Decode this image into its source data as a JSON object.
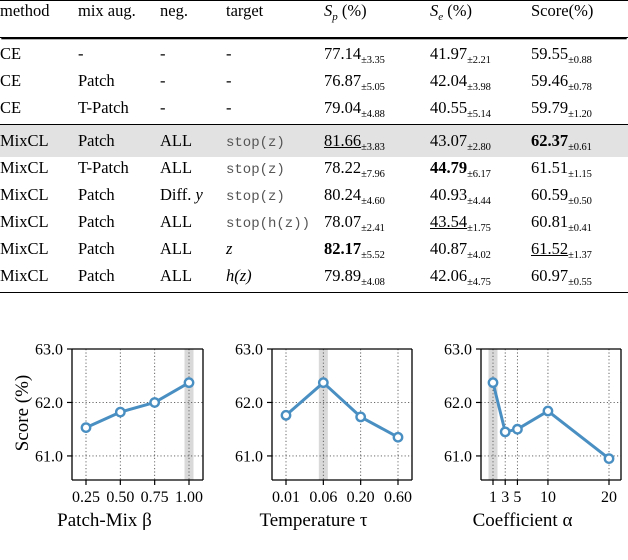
{
  "table": {
    "headers": [
      "method",
      "mix aug.",
      "neg.",
      "target",
      "Sp (%)",
      "Se (%)",
      "Score (%)"
    ],
    "header_parts": {
      "method": "method",
      "mix_aug": "mix aug.",
      "neg": "neg.",
      "target": "target",
      "sp_sym": "S",
      "sp_sub": "p",
      "sp_unit": "(%)",
      "se_sym": "S",
      "se_sub": "e",
      "se_unit": "(%)",
      "score": "Score",
      "score_unit": "(%)"
    },
    "rows": [
      {
        "method": "CE",
        "mix": "-",
        "neg": "-",
        "target": "-",
        "target_style": "plain",
        "sp": "77.14",
        "sp_err": "±3.35",
        "sp_style": "plain",
        "se": "41.97",
        "se_err": "±2.21",
        "se_style": "plain",
        "score": "59.55",
        "score_err": "±0.88",
        "score_style": "plain",
        "highlight": false
      },
      {
        "method": "CE",
        "mix": "Patch",
        "neg": "-",
        "target": "-",
        "target_style": "plain",
        "sp": "76.87",
        "sp_err": "±5.05",
        "sp_style": "plain",
        "se": "42.04",
        "se_err": "±3.98",
        "se_style": "plain",
        "score": "59.46",
        "score_err": "±0.78",
        "score_style": "plain",
        "highlight": false
      },
      {
        "method": "CE",
        "mix": "T-Patch",
        "neg": "-",
        "target": "-",
        "target_style": "plain",
        "sp": "79.04",
        "sp_err": "±4.88",
        "sp_style": "plain",
        "se": "40.55",
        "se_err": "±5.14",
        "se_style": "plain",
        "score": "59.79",
        "score_err": "±1.20",
        "score_style": "plain",
        "highlight": false
      },
      {
        "method": "MixCL",
        "mix": "Patch",
        "neg": "ALL",
        "target": "stop(z)",
        "target_style": "mono",
        "sp": "81.66",
        "sp_err": "±3.83",
        "sp_style": "underline",
        "se": "43.07",
        "se_err": "±2.80",
        "se_style": "plain",
        "score": "62.37",
        "score_err": "±0.61",
        "score_style": "bold",
        "highlight": true
      },
      {
        "method": "MixCL",
        "mix": "T-Patch",
        "neg": "ALL",
        "target": "stop(z)",
        "target_style": "mono",
        "sp": "78.22",
        "sp_err": "±7.96",
        "sp_style": "plain",
        "se": "44.79",
        "se_err": "±6.17",
        "se_style": "bold",
        "score": "61.51",
        "score_err": "±1.15",
        "score_style": "plain",
        "highlight": false
      },
      {
        "method": "MixCL",
        "mix": "Patch",
        "neg": "Diff. y",
        "neg_style": "math-y",
        "target": "stop(z)",
        "target_style": "mono",
        "sp": "80.24",
        "sp_err": "±4.60",
        "sp_style": "plain",
        "se": "40.93",
        "se_err": "±4.44",
        "se_style": "plain",
        "score": "60.59",
        "score_err": "±0.50",
        "score_style": "plain",
        "highlight": false
      },
      {
        "method": "MixCL",
        "mix": "Patch",
        "neg": "ALL",
        "target": "stop(h(z))",
        "target_style": "mono",
        "sp": "78.07",
        "sp_err": "±2.41",
        "sp_style": "plain",
        "se": "43.54",
        "se_err": "±1.75",
        "se_style": "underline",
        "score": "60.81",
        "score_err": "±0.41",
        "score_style": "plain",
        "highlight": false
      },
      {
        "method": "MixCL",
        "mix": "Patch",
        "neg": "ALL",
        "target": "z",
        "target_style": "math",
        "sp": "82.17",
        "sp_err": "±5.52",
        "sp_style": "bold",
        "se": "40.87",
        "se_err": "±4.02",
        "se_style": "plain",
        "score": "61.52",
        "score_err": "±1.37",
        "score_style": "underline",
        "highlight": false
      },
      {
        "method": "MixCL",
        "mix": "Patch",
        "neg": "ALL",
        "target": "h(z)",
        "target_style": "math",
        "sp": "79.89",
        "sp_err": "±4.08",
        "sp_style": "plain",
        "se": "42.06",
        "se_err": "±4.75",
        "se_style": "plain",
        "score": "60.97",
        "score_err": "±0.55",
        "score_style": "plain",
        "highlight": false
      }
    ]
  },
  "colors": {
    "line": "#4a8fc2",
    "marker_face": "#ffffff",
    "highlight_band": "#cccccc",
    "grid": "#555555",
    "axis": "#000000",
    "row_highlight": "#e2e2e2"
  },
  "chart_data": [
    {
      "type": "line",
      "title": "",
      "xlabel": "Patch-Mix β",
      "ylabel": "Score (%)",
      "x": [
        0.25,
        0.5,
        0.75,
        1.0
      ],
      "xtick_labels": [
        "0.25",
        "0.50",
        "0.75",
        "1.00"
      ],
      "values": [
        61.53,
        61.82,
        62.0,
        62.37
      ],
      "ytick_labels": [
        "61.0",
        "62.0",
        "63.0"
      ],
      "yticks": [
        61.0,
        62.0,
        63.0
      ],
      "ylim": [
        60.55,
        63.0
      ],
      "grid": true,
      "highlight_x": 1.0,
      "legend": "none"
    },
    {
      "type": "line",
      "title": "",
      "xlabel": "Temperature τ",
      "ylabel": "",
      "x": [
        0.01,
        0.06,
        0.2,
        0.6
      ],
      "xtick_labels": [
        "0.01",
        "0.06",
        "0.20",
        "0.60"
      ],
      "values": [
        61.76,
        62.37,
        61.73,
        61.35
      ],
      "ytick_labels": [
        "61.0",
        "62.0",
        "63.0"
      ],
      "yticks": [
        61.0,
        62.0,
        63.0
      ],
      "ylim": [
        60.55,
        63.0
      ],
      "grid": true,
      "highlight_x": 0.06,
      "legend": "none"
    },
    {
      "type": "line",
      "title": "",
      "xlabel": "Coefficient α",
      "ylabel": "",
      "x": [
        1,
        3,
        5,
        10,
        20
      ],
      "xtick_labels": [
        "1",
        "3",
        "5",
        "10",
        "20"
      ],
      "values": [
        62.37,
        61.45,
        61.5,
        61.84,
        60.95
      ],
      "ytick_labels": [
        "61.0",
        "62.0",
        "63.0"
      ],
      "yticks": [
        61.0,
        62.0,
        63.0
      ],
      "ylim": [
        60.55,
        63.0
      ],
      "grid": true,
      "highlight_x": 1,
      "legend": "none"
    }
  ]
}
